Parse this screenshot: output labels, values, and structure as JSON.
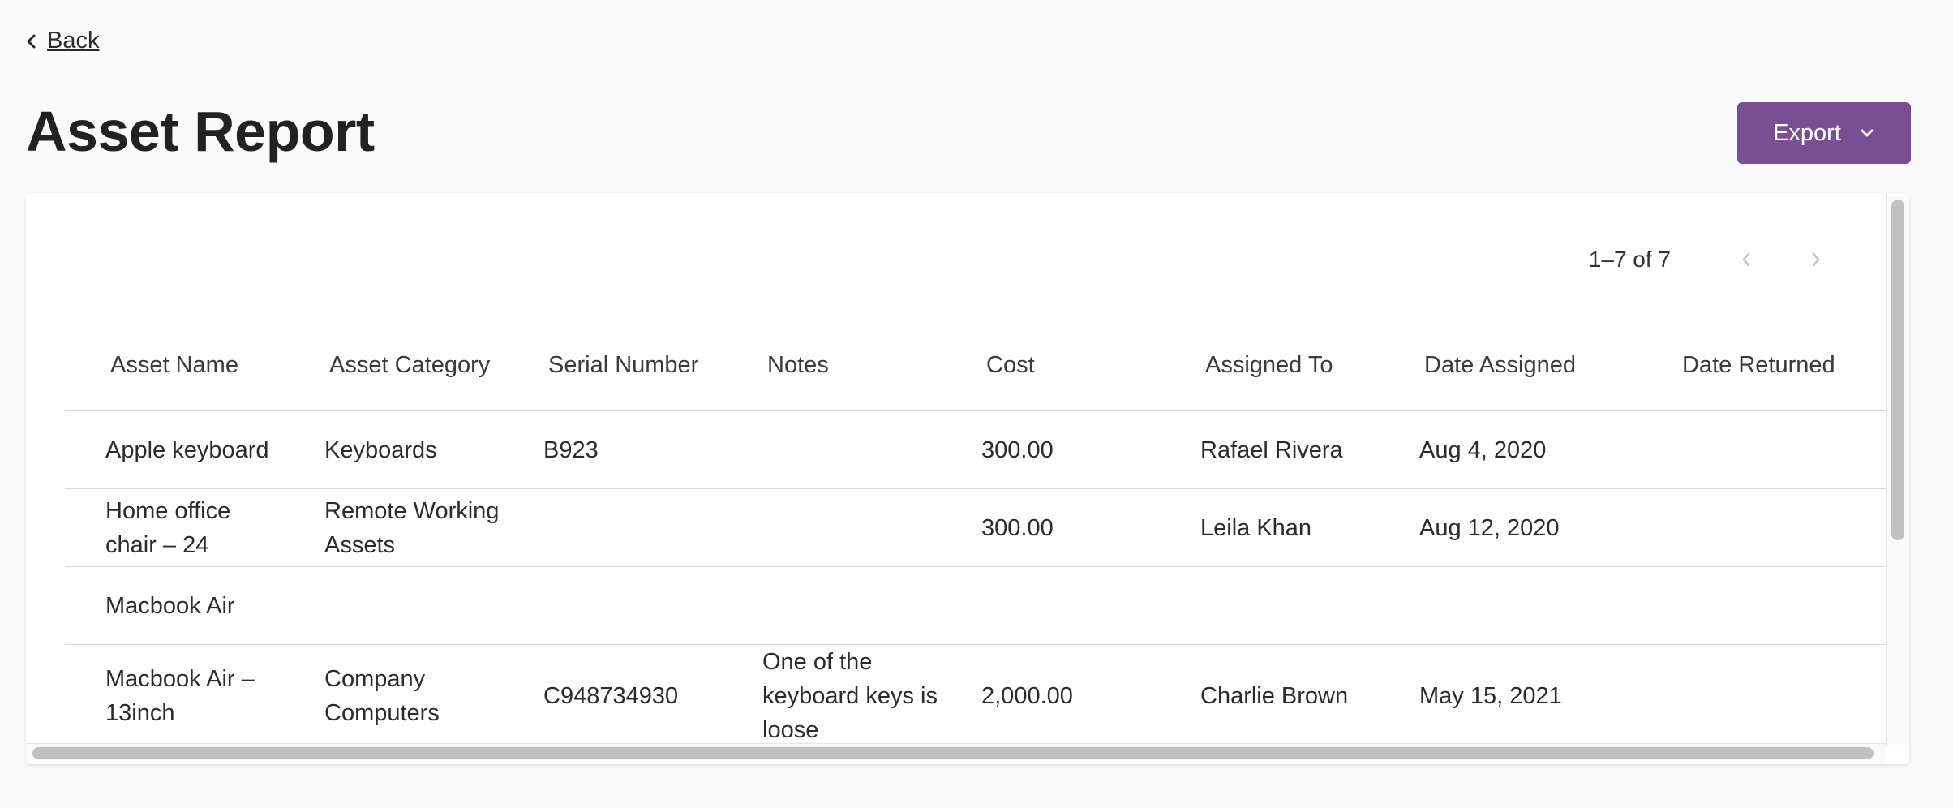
{
  "nav": {
    "back_label": "Back"
  },
  "page": {
    "title": "Asset Report"
  },
  "toolbar": {
    "export_label": "Export"
  },
  "pagination": {
    "range_text": "1–7 of 7"
  },
  "table": {
    "columns": [
      "Asset Name",
      "Asset Category",
      "Serial Number",
      "Notes",
      "Cost",
      "Assigned To",
      "Date Assigned",
      "Date Returned"
    ],
    "rows": [
      [
        "Apple keyboard",
        "Keyboards",
        "B923",
        "",
        "300.00",
        "Rafael Rivera",
        "Aug 4, 2020",
        ""
      ],
      [
        "Home office chair – 24",
        "Remote Working Assets",
        "",
        "",
        "300.00",
        "Leila Khan",
        "Aug 12, 2020",
        ""
      ],
      [
        "Macbook Air",
        "",
        "",
        "",
        "",
        "",
        "",
        ""
      ],
      [
        "Macbook Air – 13inch",
        "Company Computers",
        "C948734930",
        "One of the keyboard keys is loose",
        "2,000.00",
        "Charlie Brown",
        "May 15, 2021",
        ""
      ]
    ]
  },
  "colors": {
    "accent": "#7a4e93",
    "background": "#fafafa"
  },
  "icons": {
    "back": "chevron-left-icon",
    "export": "chevron-down-icon",
    "prev": "chevron-left-icon",
    "next": "chevron-right-icon"
  }
}
